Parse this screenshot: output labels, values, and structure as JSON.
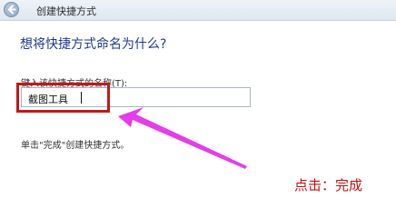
{
  "window": {
    "title": "创建快捷方式"
  },
  "dialog": {
    "heading": "想将快捷方式命名为什么?",
    "field_label": "键入该快捷方式的名称(T):",
    "name_value": "截图工具",
    "instruction": "单击\"完成\"创建快捷方式。"
  },
  "annotation": {
    "text": "点击：完成",
    "highlight_color": "#c21818",
    "arrow_color": "#e33ee8"
  },
  "icons": {
    "back": "back-arrow-icon"
  }
}
